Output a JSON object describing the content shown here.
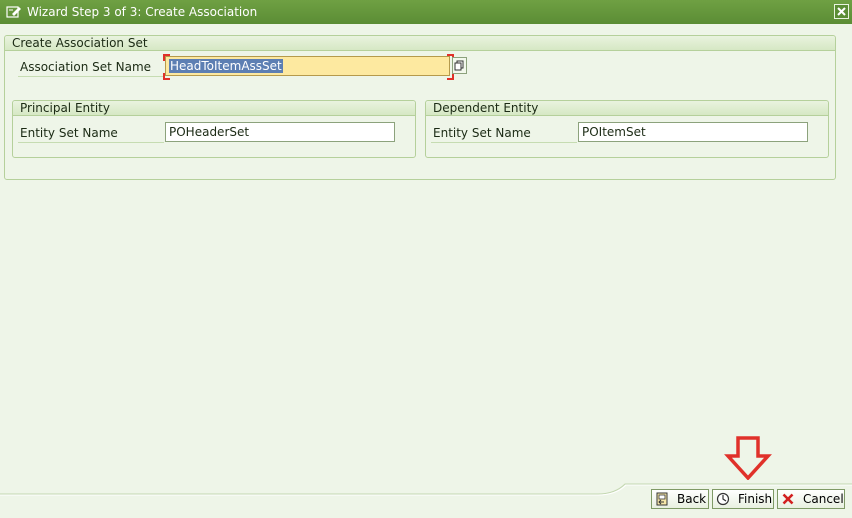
{
  "window": {
    "title": "Wizard Step 3 of 3: Create Association"
  },
  "association_set": {
    "group_title": "Create Association Set",
    "name_label": "Association Set Name",
    "name_value": "HeadToItemAssSet"
  },
  "principal": {
    "group_title": "Principal Entity",
    "set_label": "Entity Set Name",
    "set_value": "POHeaderSet"
  },
  "dependent": {
    "group_title": "Dependent Entity",
    "set_label": "Entity Set Name",
    "set_value": "POItemSet"
  },
  "footer": {
    "back_label": "Back",
    "finish_label": "Finish",
    "cancel_label": "Cancel"
  },
  "colors": {
    "titlebar": "#5b8d35",
    "background": "#eef5e8",
    "active_field": "#fde9a0",
    "selection": "#5d7fb3",
    "annotation_arrow": "#e0312a"
  },
  "icons": {
    "window": "wizard-window-icon",
    "close": "close-icon",
    "value_help": "value-help-icon",
    "back": "back-icon",
    "finish": "finish-icon",
    "cancel": "cancel-icon",
    "annotation": "red-arrow-down-icon"
  }
}
